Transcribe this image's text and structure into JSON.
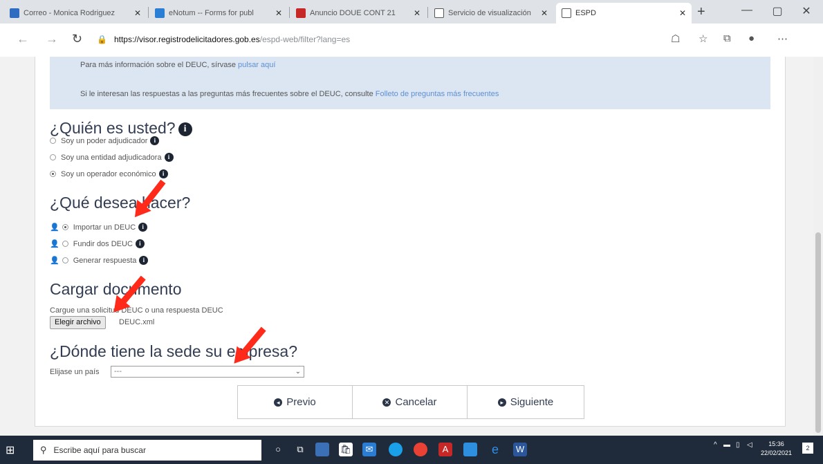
{
  "browser": {
    "tabs": [
      {
        "title": "Correo - Monica Rodriguez",
        "icon_color": "#2d6cc0",
        "active": false
      },
      {
        "title": "eNotum -- Forms for publ",
        "icon_color": "#2a7fd4",
        "active": false
      },
      {
        "title": "Anuncio DOUE CONT 21",
        "icon_color": "#c62828",
        "active": false
      },
      {
        "title": "Servicio de visualización",
        "icon_color": "#ffffff",
        "active": false
      },
      {
        "title": "ESPD",
        "icon_color": "#ffffff",
        "active": true
      }
    ],
    "new_tab_label": "+",
    "url_host": "https://visor.registrodelicitadores.gob.es",
    "url_path": "/espd-web/filter?lang=es"
  },
  "info": {
    "line1_text": "Para más información sobre el DEUC, sírvase",
    "line1_link": "pulsar aquí",
    "line2_text": "Si le interesan las respuestas a las preguntas más frecuentes sobre el DEUC, consulte",
    "line2_link": "Folleto de preguntas más frecuentes"
  },
  "who": {
    "title": "¿Quién es usted?",
    "options": [
      {
        "label": "Soy un poder adjudicador",
        "selected": false
      },
      {
        "label": "Soy una entidad adjudicadora",
        "selected": false
      },
      {
        "label": "Soy un operador económico",
        "selected": true
      }
    ]
  },
  "what": {
    "title": "¿Qué desea hacer?",
    "options": [
      {
        "label": "Importar un DEUC",
        "selected": true
      },
      {
        "label": "Fundir dos DEUC",
        "selected": false
      },
      {
        "label": "Generar respuesta",
        "selected": false
      }
    ]
  },
  "upload": {
    "title": "Cargar documento",
    "hint": "Cargue una solicitud DEUC o una respuesta DEUC",
    "button_label": "Elegir archivo",
    "file_name": "DEUC.xml"
  },
  "country": {
    "title": "¿Dónde tiene la sede su empresa?",
    "label": "Elijase un país",
    "selected_value": "---"
  },
  "wizard": {
    "previous_label": "Previo",
    "cancel_label": "Cancelar",
    "next_label": "Siguiente"
  },
  "taskbar": {
    "search_placeholder": "Escribe aquí para buscar",
    "time": "15:36",
    "date": "22/02/2021",
    "notification_count": "2"
  },
  "colors": {
    "annotation_arrow": "#ff2a1a",
    "heading": "#333d52",
    "info_background": "#dce6f2",
    "link": "#5c8fd6"
  }
}
